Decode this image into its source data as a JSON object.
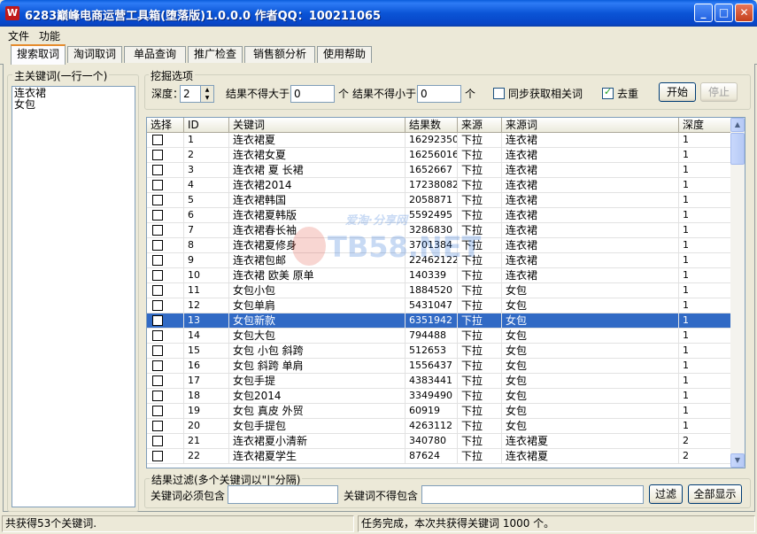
{
  "window": {
    "title": "6283巅峰电商运营工具箱(堕落版)1.0.0.0 作者QQ：100211065",
    "icon": "app-icon"
  },
  "menu": [
    "文件",
    "功能"
  ],
  "tabs": [
    "搜索取词",
    "淘词取词",
    "单品查询",
    "推广检查",
    "销售额分析",
    "使用帮助"
  ],
  "keywords_panel": {
    "legend": "主关键词(一行一个)",
    "lines": [
      "连衣裙",
      "女包"
    ]
  },
  "options": {
    "legend": "挖掘选项",
    "depth_label": "深度：",
    "depth_value": "2",
    "max_label": "结果不得大于",
    "max_value": "0",
    "unit1": "个",
    "min_label": "结果不得小于",
    "min_value": "0",
    "unit2": "个",
    "sync_label": "同步获取相关词",
    "sync_checked": false,
    "dedupe_label": "去重",
    "dedupe_checked": true,
    "start_label": "开始",
    "stop_label": "停止"
  },
  "table": {
    "columns": [
      "选择",
      "ID",
      "关键词",
      "结果数",
      "来源",
      "来源词",
      "深度"
    ],
    "selected_id": "13",
    "rows": [
      {
        "id": "1",
        "keyword": "连衣裙夏",
        "count": "16292350",
        "source": "下拉",
        "source_word": "连衣裙",
        "depth": "1"
      },
      {
        "id": "2",
        "keyword": "连衣裙女夏",
        "count": "16256016",
        "source": "下拉",
        "source_word": "连衣裙",
        "depth": "1"
      },
      {
        "id": "3",
        "keyword": "连衣裙 夏 长裙",
        "count": "1652667",
        "source": "下拉",
        "source_word": "连衣裙",
        "depth": "1"
      },
      {
        "id": "4",
        "keyword": "连衣裙2014",
        "count": "17238082",
        "source": "下拉",
        "source_word": "连衣裙",
        "depth": "1"
      },
      {
        "id": "5",
        "keyword": "连衣裙韩国",
        "count": "2058871",
        "source": "下拉",
        "source_word": "连衣裙",
        "depth": "1"
      },
      {
        "id": "6",
        "keyword": "连衣裙夏韩版",
        "count": "5592495",
        "source": "下拉",
        "source_word": "连衣裙",
        "depth": "1"
      },
      {
        "id": "7",
        "keyword": "连衣裙春长袖",
        "count": "3286830",
        "source": "下拉",
        "source_word": "连衣裙",
        "depth": "1"
      },
      {
        "id": "8",
        "keyword": "连衣裙夏修身",
        "count": "3701384",
        "source": "下拉",
        "source_word": "连衣裙",
        "depth": "1"
      },
      {
        "id": "9",
        "keyword": "连衣裙包邮",
        "count": "22462122",
        "source": "下拉",
        "source_word": "连衣裙",
        "depth": "1"
      },
      {
        "id": "10",
        "keyword": "连衣裙 欧美 原单",
        "count": "140339",
        "source": "下拉",
        "source_word": "连衣裙",
        "depth": "1"
      },
      {
        "id": "11",
        "keyword": "女包小包",
        "count": "1884520",
        "source": "下拉",
        "source_word": "女包",
        "depth": "1"
      },
      {
        "id": "12",
        "keyword": "女包单肩",
        "count": "5431047",
        "source": "下拉",
        "source_word": "女包",
        "depth": "1"
      },
      {
        "id": "13",
        "keyword": "女包新款",
        "count": "6351942",
        "source": "下拉",
        "source_word": "女包",
        "depth": "1"
      },
      {
        "id": "14",
        "keyword": "女包大包",
        "count": "794488",
        "source": "下拉",
        "source_word": "女包",
        "depth": "1"
      },
      {
        "id": "15",
        "keyword": "女包 小包 斜跨",
        "count": "512653",
        "source": "下拉",
        "source_word": "女包",
        "depth": "1"
      },
      {
        "id": "16",
        "keyword": "女包 斜跨 单肩",
        "count": "1556437",
        "source": "下拉",
        "source_word": "女包",
        "depth": "1"
      },
      {
        "id": "17",
        "keyword": "女包手提",
        "count": "4383441",
        "source": "下拉",
        "source_word": "女包",
        "depth": "1"
      },
      {
        "id": "18",
        "keyword": "女包2014",
        "count": "3349490",
        "source": "下拉",
        "source_word": "女包",
        "depth": "1"
      },
      {
        "id": "19",
        "keyword": "女包 真皮 外贸",
        "count": "60919",
        "source": "下拉",
        "source_word": "女包",
        "depth": "1"
      },
      {
        "id": "20",
        "keyword": "女包手提包",
        "count": "4263112",
        "source": "下拉",
        "source_word": "女包",
        "depth": "1"
      },
      {
        "id": "21",
        "keyword": "连衣裙夏小清新",
        "count": "340780",
        "source": "下拉",
        "source_word": "连衣裙夏",
        "depth": "2"
      },
      {
        "id": "22",
        "keyword": "连衣裙夏学生",
        "count": "87624",
        "source": "下拉",
        "source_word": "连衣裙夏",
        "depth": "2"
      }
    ]
  },
  "filter": {
    "legend": "结果过滤(多个关键词以\"|\"分隔)",
    "include_label": "关键词必须包含",
    "include_value": "",
    "exclude_label": "关键词不得包含",
    "exclude_value": "",
    "filter_label": "过滤",
    "show_all_label": "全部显示"
  },
  "watermark": {
    "text": "TB58.NET",
    "sub": "爱淘·分享网"
  },
  "status": {
    "left": "共获得53个关键词.",
    "right": "任务完成，本次共获得关键词 1000 个。"
  }
}
